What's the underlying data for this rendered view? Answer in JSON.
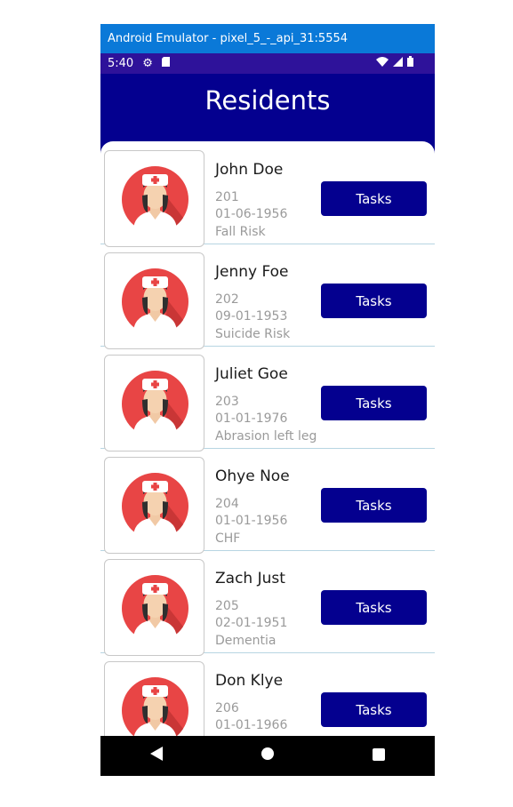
{
  "window": {
    "title": "Android Emulator - pixel_5_-_api_31:5554"
  },
  "status_bar": {
    "time": "5:40"
  },
  "header": {
    "title": "Residents"
  },
  "residents": [
    {
      "name": "John Doe",
      "room": "201",
      "dob": "01-06-1956",
      "note": "Fall Risk"
    },
    {
      "name": "Jenny Foe",
      "room": "202",
      "dob": "09-01-1953",
      "note": "Suicide Risk"
    },
    {
      "name": "Juliet Goe",
      "room": "203",
      "dob": "01-01-1976",
      "note": "Abrasion left leg"
    },
    {
      "name": "Ohye Noe",
      "room": "204",
      "dob": "01-01-1956",
      "note": "CHF"
    },
    {
      "name": "Zach Just",
      "room": "205",
      "dob": "02-01-1951",
      "note": "Dementia"
    },
    {
      "name": "Don Klye",
      "room": "206",
      "dob": "01-01-1966",
      "note": ""
    }
  ],
  "tasks_label": "Tasks",
  "nav": {
    "back_icon": "back-triangle-icon",
    "home_icon": "home-circle-icon",
    "recents_icon": "recents-square-icon"
  },
  "colors": {
    "titlebar": "#0a79d8",
    "statusbar": "#2e129a",
    "header": "#04008f",
    "button": "#04008f",
    "avatar": "#e84545"
  }
}
